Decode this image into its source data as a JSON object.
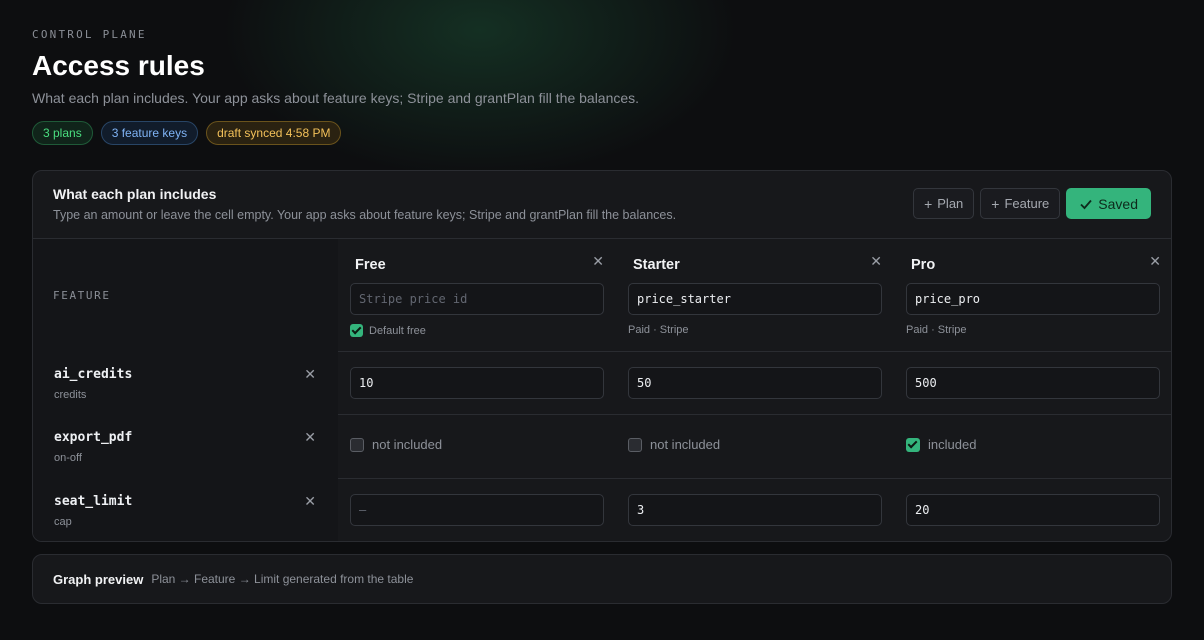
{
  "header": {
    "eyebrow": "CONTROL PLANE",
    "title": "Access rules",
    "subtitle": "What each plan includes. Your app asks about feature keys; Stripe and grantPlan fill the balances.",
    "badges": [
      "3 plans",
      "3 feature keys",
      "draft synced 4:58 PM"
    ]
  },
  "card": {
    "title": "What each plan includes",
    "subtitle": "Type an amount or leave the cell empty. Your app asks about feature keys; Stripe and grantPlan fill the balances.",
    "add_plan_label": "Plan",
    "add_feature_label": "Feature",
    "saved_label": "Saved",
    "feature_column_label": "FEATURE"
  },
  "plans": [
    {
      "name": "Free",
      "price_value": "",
      "price_placeholder": "Stripe price id",
      "meta": "Default free",
      "default_free_checked": true
    },
    {
      "name": "Starter",
      "price_value": "price_starter",
      "price_placeholder": "Stripe price id",
      "meta": "Paid · Stripe"
    },
    {
      "name": "Pro",
      "price_value": "price_pro",
      "price_placeholder": "Stripe price id",
      "meta": "Paid · Stripe"
    }
  ],
  "features": [
    {
      "key": "ai_credits",
      "type": "credits",
      "values": [
        "10",
        "50",
        "500"
      ]
    },
    {
      "key": "export_pdf",
      "type": "on-off",
      "values": [
        {
          "checked": false,
          "label": "not included"
        },
        {
          "checked": false,
          "label": "not included"
        },
        {
          "checked": true,
          "label": "included"
        }
      ]
    },
    {
      "key": "seat_limit",
      "type": "cap",
      "values": [
        "",
        "3",
        "20"
      ],
      "empty_placeholder": "—"
    }
  ],
  "preview": {
    "title": "Graph preview",
    "subtitle": "Plan → Feature → Limit generated from the table"
  },
  "colors": {
    "accent": "#34b47c",
    "background": "#0d0e10",
    "card": "#17181b"
  },
  "icons": {
    "remove": "close-icon",
    "add": "plus-icon",
    "saved": "check-icon"
  }
}
